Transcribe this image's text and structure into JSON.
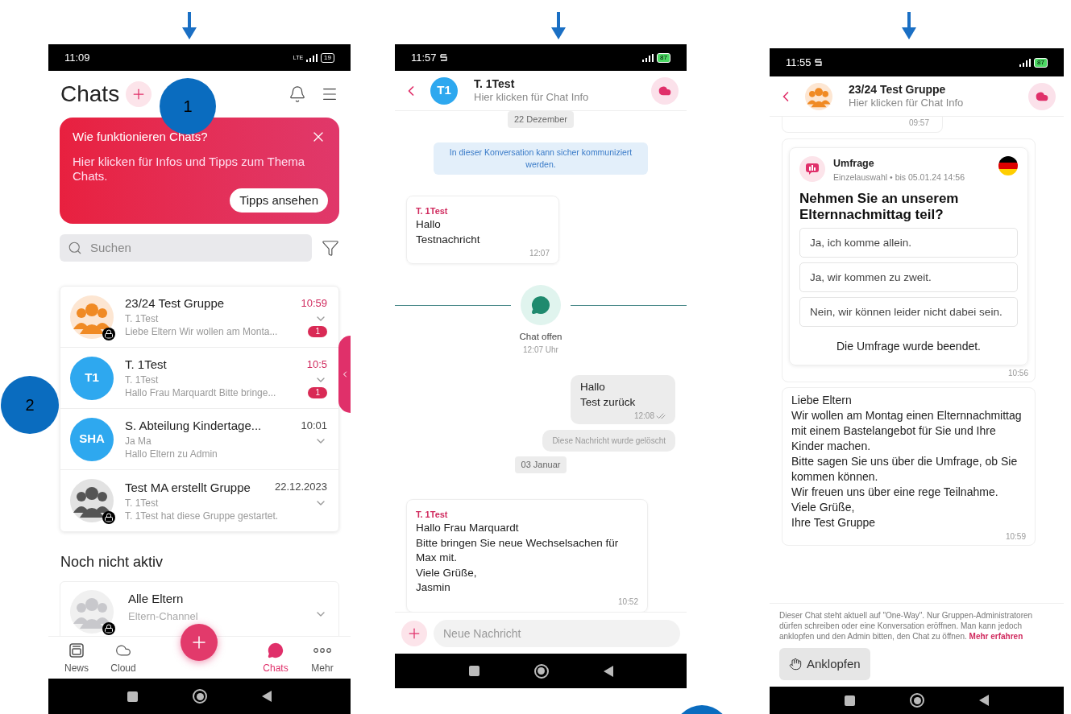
{
  "annotations": [
    {
      "label": "1"
    },
    {
      "label": "2"
    }
  ],
  "chat_list_screen": {
    "status_bar": {
      "time": "11:09",
      "network": "LTE",
      "battery": "19"
    },
    "title": "Chats",
    "banner": {
      "title": "Wie funktionieren Chats?",
      "text": "Hier klicken für Infos und Tipps zum Thema Chats.",
      "button": "Tipps ansehen"
    },
    "search": {
      "placeholder": "Suchen"
    },
    "chats": [
      {
        "name": "23/24 Test Gruppe",
        "time": "10:59",
        "sender": "T. 1Test",
        "preview": "Liebe Eltern Wir wollen am Monta...",
        "unread_count": "1",
        "locked": true,
        "avatar": {
          "kind": "group"
        }
      },
      {
        "name": "T. 1Test",
        "time": "10:5",
        "sender": "T. 1Test",
        "preview": "Hallo Frau Marquardt Bitte bringe...",
        "unread_count": "1",
        "locked": false,
        "avatar": {
          "kind": "initials",
          "text": "T1"
        }
      },
      {
        "name": "S. Abteilung Kindertage...",
        "time": "10:01",
        "sender": "Ja Ma",
        "preview": "Hallo Eltern zu Admin",
        "locked": false,
        "avatar": {
          "kind": "initials",
          "text": "SHA"
        }
      },
      {
        "name": "Test MA erstellt Gruppe",
        "time": "22.12.2023",
        "sender": "T. 1Test",
        "preview": "T. 1Test hat diese Gruppe gestartet.",
        "locked": true,
        "avatar": {
          "kind": "people"
        }
      }
    ],
    "section_title": "Noch nicht aktiv",
    "inactive_chats": [
      {
        "name": "Alle Eltern",
        "subtitle": "Eltern-Channel",
        "locked": true,
        "avatar": {
          "kind": "group-inactive"
        }
      }
    ],
    "nav": [
      {
        "label": "News",
        "selected": false,
        "kind": "news"
      },
      {
        "label": "Cloud",
        "selected": false,
        "kind": "cloud"
      },
      {
        "label": "Chats",
        "selected": true,
        "kind": "chats"
      },
      {
        "label": "Mehr",
        "selected": false,
        "kind": "more"
      }
    ]
  },
  "conversation_screen": {
    "status_bar": {
      "time": "11:57",
      "battery": "87"
    },
    "header": {
      "name": "T. 1Test",
      "subtitle": "Hier klicken für Chat Info",
      "avatar": {
        "kind": "initials",
        "text": "T1"
      }
    },
    "messages": [
      {
        "kind": "date",
        "text": "22 Dezember"
      },
      {
        "kind": "info",
        "text": "In dieser Konversation kann sicher kommuniziert werden."
      },
      {
        "kind": "incoming",
        "sender": "T. 1Test",
        "text": "Hallo\nTestnachricht",
        "time": "12:07"
      },
      {
        "kind": "event",
        "label": "Chat offen",
        "time": "12:07 Uhr"
      },
      {
        "kind": "outgoing",
        "text": "Hallo\nTest zurück",
        "time": "12:08",
        "read": true
      },
      {
        "kind": "deleted",
        "text": "Diese Nachricht wurde gelöscht"
      },
      {
        "kind": "date",
        "text": "03 Januar"
      },
      {
        "kind": "incoming",
        "sender": "T. 1Test",
        "text": "Hallo Frau Marquardt\nBitte bringen Sie neue Wechselsachen für Max mit.\nViele Grüße,\nJasmin",
        "time": "10:52"
      }
    ],
    "composer": {
      "placeholder": "Neue Nachricht"
    }
  },
  "group_screen": {
    "status_bar": {
      "time": "11:55",
      "battery": "87"
    },
    "header": {
      "name": "23/24 Test Gruppe",
      "subtitle": "Hier klicken für Chat Info",
      "avatar": {
        "kind": "group"
      }
    },
    "messages": [
      {
        "kind": "stub",
        "time": "09:57"
      },
      {
        "kind": "poll",
        "title": "Umfrage",
        "meta": "Einzelauswahl • bis 05.01.24 14:56",
        "question": "Nehmen Sie an unserem Elternnachmittag teil?",
        "options": [
          "Ja, ich komme allein.",
          "Ja, wir kommen zu zweit.",
          "Nein, wir können leider nicht dabei sein."
        ],
        "result": "Die Umfrage wurde beendet.",
        "time": "10:56"
      },
      {
        "kind": "text",
        "text": "Liebe Eltern\nWir wollen am Montag einen Elternnachmittag mit einem Bastelangebot für Sie und Ihre Kinder machen.\nBitte sagen Sie uns über die Umfrage, ob Sie kommen können.\nWir freuen uns über eine rege Teilnahme.\nViele Grüße,\nIhre Test Gruppe",
        "time": "10:59"
      }
    ],
    "notice": {
      "text": "Dieser Chat steht aktuell auf \"One-Way\". Nur Gruppen-Administratoren dürfen schreiben oder eine Konversation eröffnen. Man kann jedoch anklopfen und den Admin bitten, den Chat zu öffnen.",
      "link": "Mehr erfahren"
    },
    "button": "Anklopfen"
  }
}
